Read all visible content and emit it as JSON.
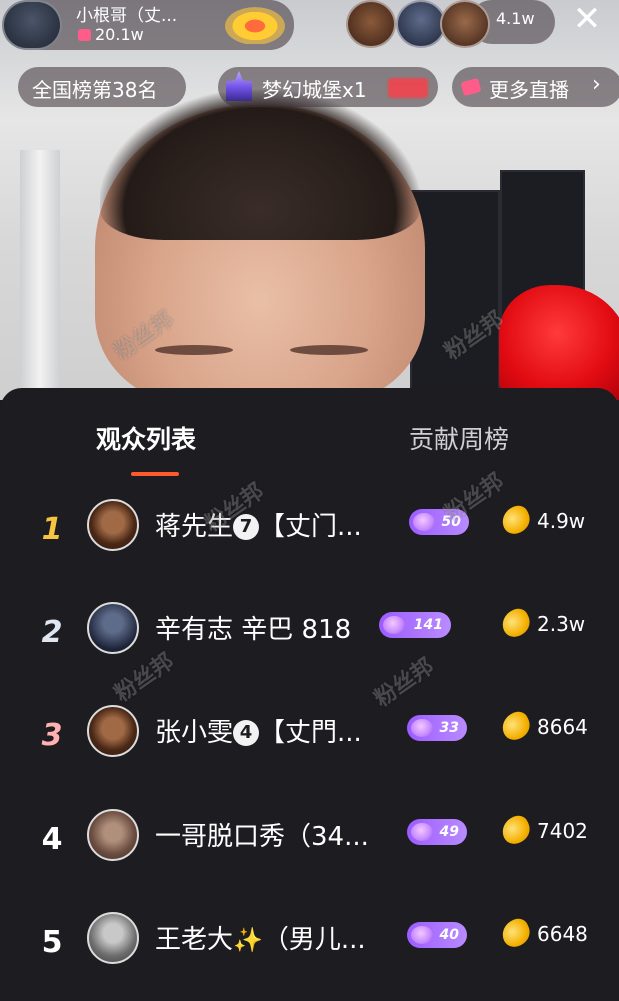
{
  "header": {
    "host_name": "小根哥（丈...",
    "host_likes": "20.1w",
    "viewer_count": "4.1w",
    "close_glyph": "✕"
  },
  "banner": {
    "rank_text": "全国榜第38名",
    "castle_text": "梦幻城堡x1",
    "more_text": "更多直播",
    "more_chevron": "›"
  },
  "tabs": {
    "audience": "观众列表",
    "contribution": "贡献周榜"
  },
  "viewers": [
    {
      "rank": "1",
      "name": "蒋先生",
      "badge": "7",
      "suffix": "【丈门...",
      "level": "50",
      "score": "4.9w",
      "rank_color": "#f5c542"
    },
    {
      "rank": "2",
      "name": "辛有志 辛巴 818",
      "badge": "",
      "suffix": "",
      "level": "141",
      "score": "2.3w",
      "rank_color": "#dfe6f0"
    },
    {
      "rank": "3",
      "name": "张小雯",
      "badge": "4",
      "suffix": "【丈門...",
      "level": "33",
      "score": "8664",
      "rank_color": "#ffb0b3"
    },
    {
      "rank": "4",
      "name": "一哥脱口秀（34...",
      "badge": "",
      "suffix": "",
      "level": "49",
      "score": "7402",
      "rank_color": "#ffffff"
    },
    {
      "rank": "5",
      "name": "王老大",
      "badge": "",
      "suffix": "（男儿...",
      "level": "40",
      "score": "6648",
      "rank_color": "#ffffff",
      "sparkle": "✨"
    }
  ],
  "watermark": "粉丝邦",
  "colors": {
    "accent": "#ff5a2c",
    "level_badge": "#9c5cff",
    "sheet_bg": "#1c1c21"
  }
}
